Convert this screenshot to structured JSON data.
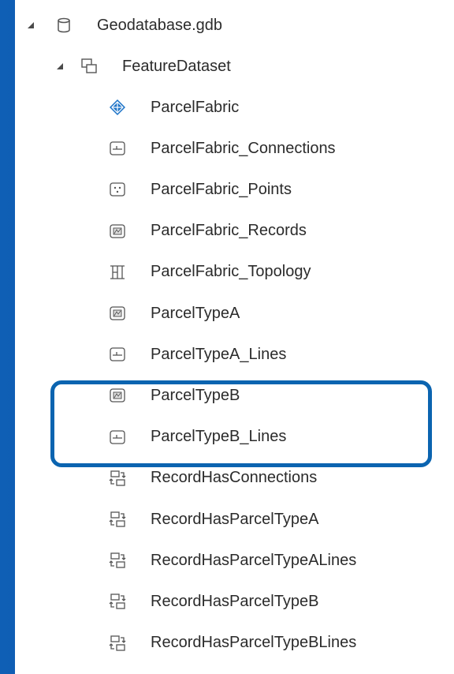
{
  "tree": {
    "root": {
      "label": "Geodatabase.gdb",
      "icon": "database-icon"
    },
    "dataset": {
      "label": "FeatureDataset",
      "icon": "feature-dataset-icon"
    },
    "items": [
      {
        "label": "ParcelFabric",
        "icon": "parcel-fabric-icon"
      },
      {
        "label": "ParcelFabric_Connections",
        "icon": "line-feature-class-icon"
      },
      {
        "label": "ParcelFabric_Points",
        "icon": "point-feature-class-icon"
      },
      {
        "label": "ParcelFabric_Records",
        "icon": "polygon-feature-class-icon"
      },
      {
        "label": "ParcelFabric_Topology",
        "icon": "topology-icon"
      },
      {
        "label": "ParcelTypeA",
        "icon": "polygon-feature-class-icon"
      },
      {
        "label": "ParcelTypeA_Lines",
        "icon": "line-feature-class-icon"
      },
      {
        "label": "ParcelTypeB",
        "icon": "polygon-feature-class-icon"
      },
      {
        "label": "ParcelTypeB_Lines",
        "icon": "line-feature-class-icon"
      },
      {
        "label": "RecordHasConnections",
        "icon": "relationship-class-icon"
      },
      {
        "label": "RecordHasParcelTypeA",
        "icon": "relationship-class-icon"
      },
      {
        "label": "RecordHasParcelTypeALines",
        "icon": "relationship-class-icon"
      },
      {
        "label": "RecordHasParcelTypeB",
        "icon": "relationship-class-icon"
      },
      {
        "label": "RecordHasParcelTypeBLines",
        "icon": "relationship-class-icon"
      }
    ]
  },
  "colors": {
    "background": "#0c56a8",
    "highlight": "#0b64b0",
    "icon_blue": "#1e74c8",
    "text": "#2b2b2b"
  }
}
